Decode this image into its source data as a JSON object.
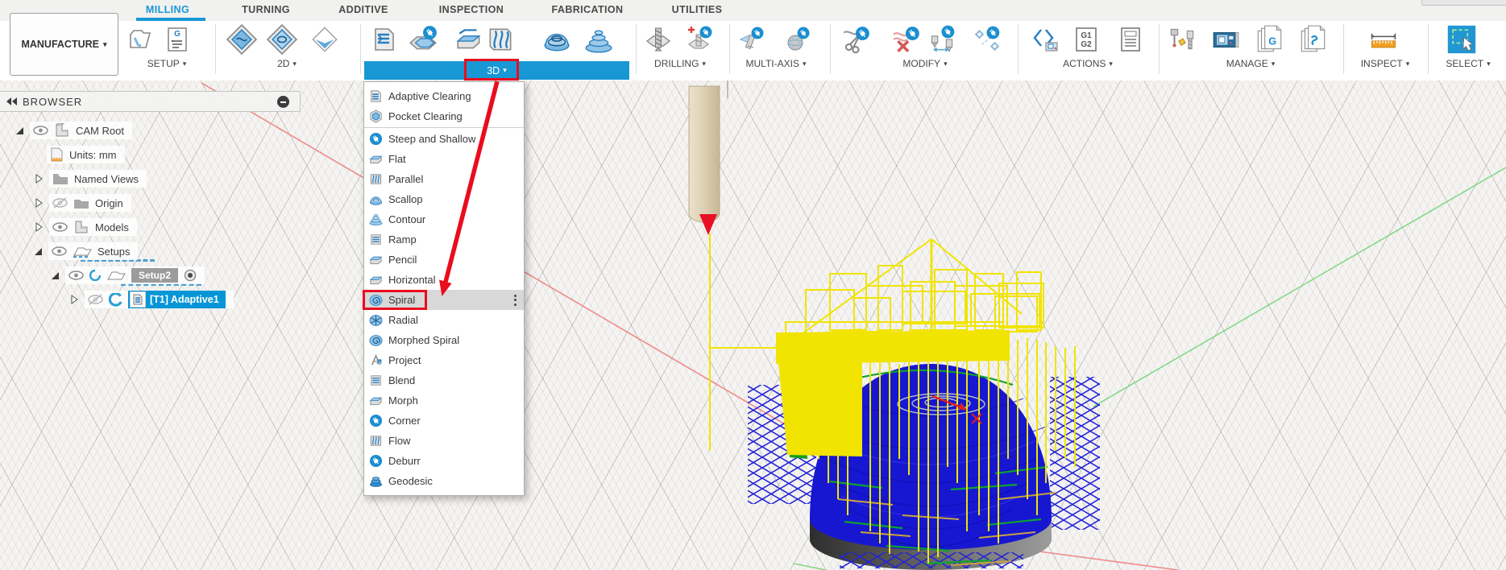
{
  "ui": {
    "caret": "▾"
  },
  "app": {
    "workspace_button": "MANUFACTURE"
  },
  "tabs": [
    {
      "label": "MILLING",
      "active": true
    },
    {
      "label": "TURNING"
    },
    {
      "label": "ADDITIVE"
    },
    {
      "label": "INSPECTION"
    },
    {
      "label": "FABRICATION"
    },
    {
      "label": "UTILITIES"
    }
  ],
  "toolbar": {
    "groups": [
      {
        "id": "setup",
        "label": "SETUP"
      },
      {
        "id": "2d",
        "label": "2D"
      },
      {
        "id": "3d",
        "label": "3D",
        "selected": true
      },
      {
        "id": "drilling",
        "label": "DRILLING"
      },
      {
        "id": "multi-axis",
        "label": "MULTI-AXIS"
      },
      {
        "id": "modify",
        "label": "MODIFY"
      },
      {
        "id": "actions",
        "label": "ACTIONS"
      },
      {
        "id": "manage",
        "label": "MANAGE"
      },
      {
        "id": "inspect",
        "label": "INSPECT"
      },
      {
        "id": "select",
        "label": "SELECT"
      }
    ],
    "selected_group_color": "#1798d5"
  },
  "menu": {
    "items": [
      {
        "label": "Adaptive Clearing",
        "icon": "block"
      },
      {
        "label": "Pocket Clearing",
        "icon": "hex",
        "divider_after": true
      },
      {
        "label": "Steep and Shallow",
        "icon": "badge"
      },
      {
        "label": "Flat",
        "icon": "slab"
      },
      {
        "label": "Parallel",
        "icon": "waves"
      },
      {
        "label": "Scallop",
        "icon": "dome"
      },
      {
        "label": "Contour",
        "icon": "terrace"
      },
      {
        "label": "Ramp",
        "icon": "stack"
      },
      {
        "label": "Pencil",
        "icon": "slab"
      },
      {
        "label": "Horizontal",
        "icon": "slab"
      },
      {
        "label": "Spiral",
        "icon": "spiral",
        "highlighted": true,
        "context_menu_dots": true,
        "annotated": true
      },
      {
        "label": "Radial",
        "icon": "radial"
      },
      {
        "label": "Morphed Spiral",
        "icon": "spiral"
      },
      {
        "label": "Project",
        "icon": "project"
      },
      {
        "label": "Blend",
        "icon": "stack"
      },
      {
        "label": "Morph",
        "icon": "slab"
      },
      {
        "label": "Corner",
        "icon": "badge"
      },
      {
        "label": "Flow",
        "icon": "waves"
      },
      {
        "label": "Deburr",
        "icon": "badge"
      },
      {
        "label": "Geodesic",
        "icon": "geodesic"
      }
    ]
  },
  "browser": {
    "header": "BROWSER",
    "rows": [
      {
        "label": "CAM Root"
      },
      {
        "label": "Units: mm"
      },
      {
        "label": "Named Views"
      },
      {
        "label": "Origin"
      },
      {
        "label": "Models"
      },
      {
        "label": "Setups"
      },
      {
        "label": "Setup2"
      },
      {
        "label": "[T1] Adaptive1"
      }
    ]
  },
  "annotations": {
    "color": "#ea0c1e",
    "boxes": [
      "3d-group-label",
      "spiral-menu-item"
    ],
    "arrow": "3d-button-to-spiral-item"
  },
  "canvas": {
    "colors": {
      "background": "#f5f4f2",
      "toolpath_yellow": "#f0e400",
      "toolpath_blue": "#1c1cd8",
      "toolpath_green": "#0da32f",
      "links_tan": "#c9a23e",
      "stock_gray": "#5a5a5a",
      "tool_tan": "#d8c8a4",
      "axis_red": "#ef8a8a",
      "axis_green": "#86d886"
    }
  }
}
